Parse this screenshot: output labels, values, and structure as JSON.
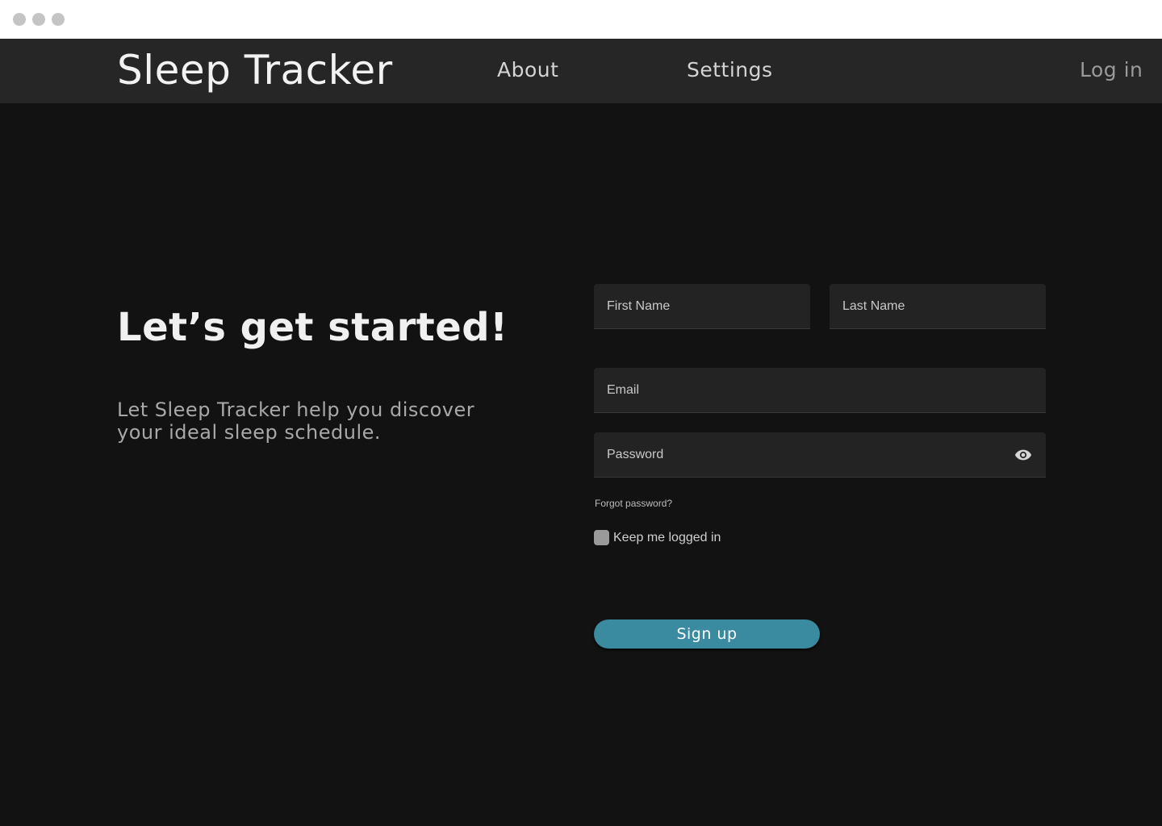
{
  "window": {
    "controls": [
      "close-dot",
      "minimize-dot",
      "maximize-dot"
    ]
  },
  "navbar": {
    "brand": "Sleep Tracker",
    "links": [
      {
        "label": "About"
      },
      {
        "label": "Settings"
      }
    ],
    "login_label": "Log in"
  },
  "hero": {
    "headline": "Let’s get started!",
    "subtext": "Let Sleep Tracker help you discover your ideal sleep schedule."
  },
  "form": {
    "first_name": {
      "placeholder": "First Name",
      "value": ""
    },
    "last_name": {
      "placeholder": "Last Name",
      "value": ""
    },
    "email": {
      "placeholder": "Email",
      "value": ""
    },
    "password": {
      "placeholder": "Password",
      "value": "",
      "toggle_icon": "eye-icon"
    },
    "forgot_label": "Forgot password?",
    "keep_logged_in": {
      "label": "Keep me logged in",
      "checked": false
    },
    "submit_label": "Sign up"
  },
  "colors": {
    "background": "#121212",
    "navbar": "#262626",
    "field": "#232323",
    "accent": "#3a8aa0"
  }
}
